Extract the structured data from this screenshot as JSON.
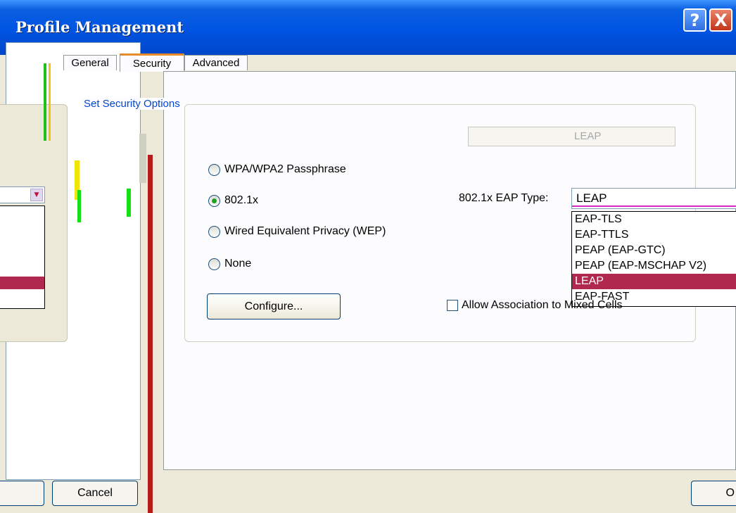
{
  "window": {
    "title": "Profile Management"
  },
  "title_buttons": {
    "help": "?",
    "close": "X"
  },
  "tabs": [
    {
      "label": "General"
    },
    {
      "label": "Security"
    },
    {
      "label": "Advanced"
    }
  ],
  "security": {
    "group_label": "Set Security Options",
    "options": [
      {
        "label": "WPA/WPA2 Passphrase",
        "checked": false
      },
      {
        "label": "802.1x",
        "checked": true
      },
      {
        "label": "Wired Equivalent Privacy (WEP)",
        "checked": false
      },
      {
        "label": "None",
        "checked": false
      }
    ],
    "eap_type_label": "802.1x EAP Type:",
    "eap_type_value": "LEAP",
    "eap_dropdown": [
      "EAP-TLS",
      "EAP-TTLS",
      "PEAP (EAP-GTC)",
      "PEAP (EAP-MSCHAP V2)",
      "LEAP",
      "EAP-FAST"
    ],
    "eap_selected": "LEAP",
    "ghost_combo_value": "LEAP",
    "configure_label": "Configure...",
    "mixed_cells_label": "Allow Association to Mixed Cells",
    "mixed_cells_checked": false
  },
  "buttons": {
    "cancel": "Cancel",
    "ok": "O"
  },
  "colors": {
    "titlebar": "#0054e3",
    "selection": "#b0284e",
    "group_label": "#0046d5",
    "red_bar": "#b51b1b"
  }
}
